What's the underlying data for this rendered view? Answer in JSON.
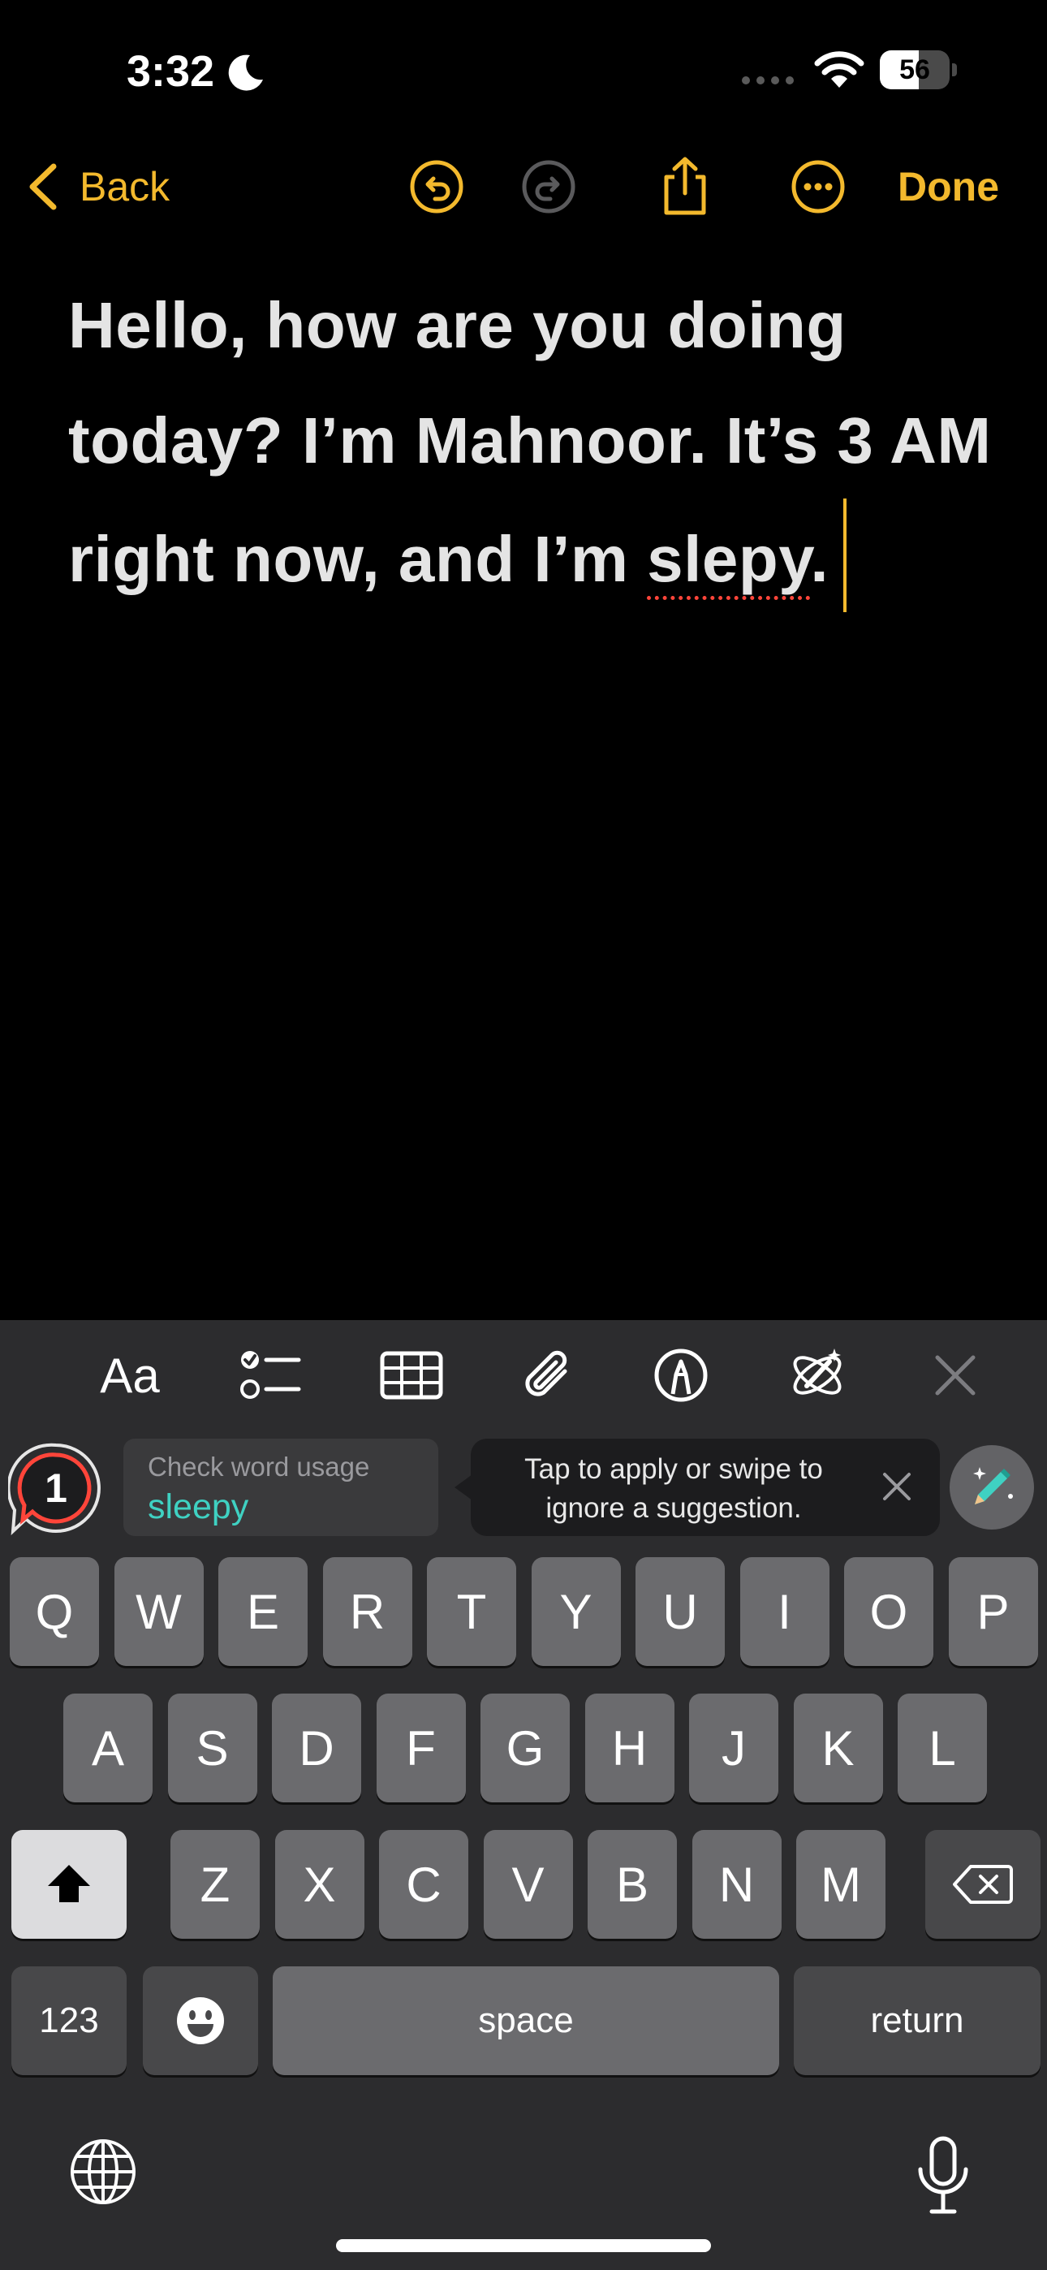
{
  "status_bar": {
    "time": "3:32",
    "battery": "56",
    "battery_level_percent": 56
  },
  "nav": {
    "back_label": "Back",
    "done_label": "Done",
    "icons": [
      "undo-icon",
      "redo-icon",
      "share-icon",
      "more-icon"
    ]
  },
  "note": {
    "text_before": "Hello, how are you doing today? I’m Mahnoor. It’s 3 AM right now, and I’m ",
    "misspelled_word": "slepy",
    "text_after": "."
  },
  "format_toolbar": {
    "aa_label": "Aa",
    "icons": [
      "checklist-icon",
      "table-icon",
      "attachment-icon",
      "markup-pen-icon",
      "writing-tools-icon",
      "close-icon"
    ]
  },
  "suggestions": {
    "count": "1",
    "card_label": "Check word usage",
    "suggested_word": "sleepy",
    "tip_text": "Tap to apply or swipe to ignore a suggestion."
  },
  "keyboard": {
    "row1": [
      "Q",
      "W",
      "E",
      "R",
      "T",
      "Y",
      "U",
      "I",
      "O",
      "P"
    ],
    "row2": [
      "A",
      "S",
      "D",
      "F",
      "G",
      "H",
      "J",
      "K",
      "L"
    ],
    "row3": [
      "Z",
      "X",
      "C",
      "V",
      "B",
      "N",
      "M"
    ],
    "numbers_label": "123",
    "space_label": "space",
    "return_label": "return"
  },
  "colors": {
    "accent": "#f3b92d",
    "suggestion": "#3fd1c2",
    "error_underline": "#ff453a"
  }
}
